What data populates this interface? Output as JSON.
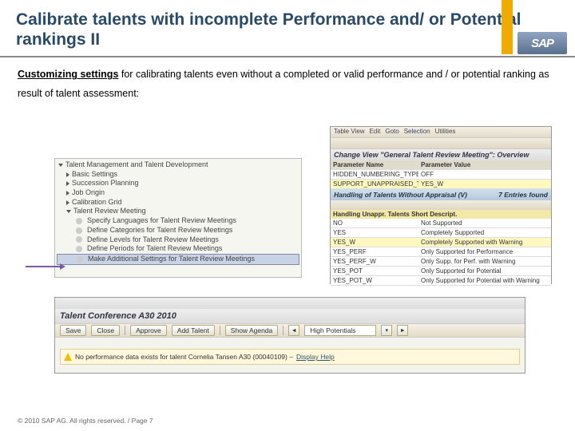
{
  "brand": "SAP",
  "title": "Calibrate talents with incomplete Performance and/ or Potential rankings II",
  "desc_lead": "Customizing settings",
  "desc_rest": " for calibrating talents even without a completed or valid performance and / or potential ranking as result of talent assessment:",
  "tree": {
    "root": "Talent Management and Talent Development",
    "items": [
      "Basic Settings",
      "Succession Planning",
      "Job Origin",
      "Calibration Grid",
      "Talent Review Meeting"
    ],
    "subitems": [
      "Specify Languages for Talent Review Meetings",
      "Define Categories for Talent Review Meetings",
      "Define Levels for Talent Review Meetings",
      "Define Periods for Talent Review Meetings",
      "Make Additional Settings for Talent Review Meetings"
    ]
  },
  "right": {
    "toolbar": [
      "Table View",
      "Edit",
      "Goto",
      "Selection",
      "Utilities"
    ],
    "title": "Change View \"General Talent Review Meeting\": Overview",
    "headers": [
      "Parameter Name",
      "Parameter Value"
    ],
    "rows": [
      [
        "HIDDEN_NUMBERING_TYPE",
        "OFF"
      ],
      [
        "SUPPORT_UNAPPRAISED_TALENTS",
        "YES_W"
      ]
    ],
    "sub_title": "Handling of Talents Without Appraisal (V)",
    "sub_count": "7 Entries found",
    "sub_banner": "Handling Unappr. Talents Short Descript.",
    "sub_rows": [
      [
        "NO",
        "Not Supported"
      ],
      [
        "YES",
        "Completely Supported"
      ],
      [
        "YES_W",
        "Completely Supported with Warning"
      ],
      [
        "YES_PERF",
        "Only Supported for Performance"
      ],
      [
        "YES_PERF_W",
        "Only Supp. for Perf. with Warning"
      ],
      [
        "YES_POT",
        "Only Supported for Potential"
      ],
      [
        "YES_POT_W",
        "Only Supported for Potential with Warning"
      ]
    ]
  },
  "bottom": {
    "title": "Talent Conference A30 2010",
    "buttons": [
      "Save",
      "Close",
      "Approve",
      "Add Talent",
      "Show Agenda"
    ],
    "field": "High Potentials",
    "warning_text": "No performance data exists for talent Cornelia Tansen A30 (00040109) – ",
    "warning_link": "Display Help"
  },
  "footer": "© 2010 SAP AG. All rights reserved. / Page 7"
}
